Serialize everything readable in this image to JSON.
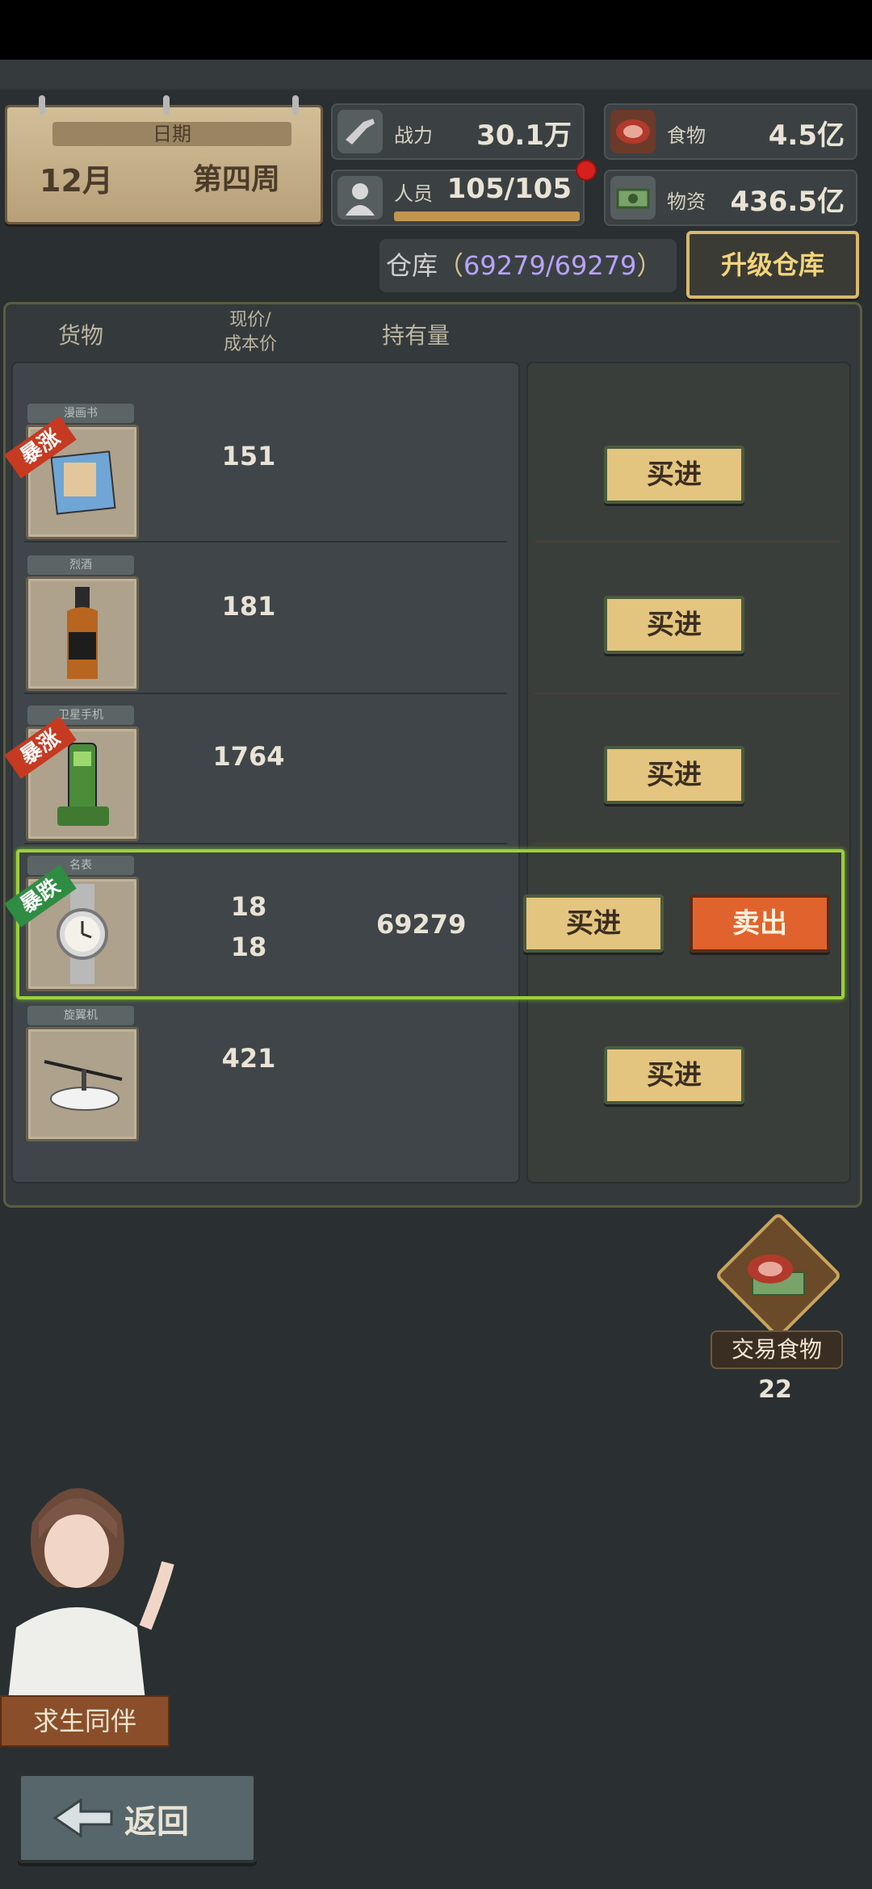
{
  "header": {
    "date_label": "日期",
    "month": "12月",
    "week": "第四周",
    "power_label": "战力",
    "power_value": "30.1万",
    "food_label": "食物",
    "food_value": "4.5亿",
    "personnel_label": "人员",
    "personnel_value": "105/105",
    "supplies_label": "物资",
    "supplies_value": "436.5亿"
  },
  "warehouse": {
    "label": "仓库",
    "open_paren": "（",
    "capacity": "69279/69279",
    "close_paren": "）",
    "upgrade_label": "升级仓库"
  },
  "table": {
    "col_goods": "货物",
    "col_price_line1": "现价/",
    "col_price_line2": "成本价",
    "col_holding": "持有量",
    "rows": [
      {
        "tag": "漫画书",
        "price": "151",
        "cost": "",
        "holding": "",
        "badge": "暴涨",
        "buy": "买进",
        "sell": ""
      },
      {
        "tag": "烈酒",
        "price": "181",
        "cost": "",
        "holding": "",
        "badge": "",
        "buy": "买进",
        "sell": ""
      },
      {
        "tag": "卫星手机",
        "price": "1764",
        "cost": "",
        "holding": "",
        "badge": "暴涨",
        "buy": "买进",
        "sell": ""
      },
      {
        "tag": "名表",
        "price": "18",
        "cost": "18",
        "holding": "69279",
        "badge": "暴跌",
        "buy": "买进",
        "sell": "卖出"
      },
      {
        "tag": "旋翼机",
        "price": "421",
        "cost": "",
        "holding": "",
        "badge": "",
        "buy": "买进",
        "sell": ""
      }
    ]
  },
  "trade_food": {
    "label": "交易食物",
    "count": "22"
  },
  "companion": {
    "label": "求生同伴"
  },
  "back": {
    "label": "返回"
  }
}
